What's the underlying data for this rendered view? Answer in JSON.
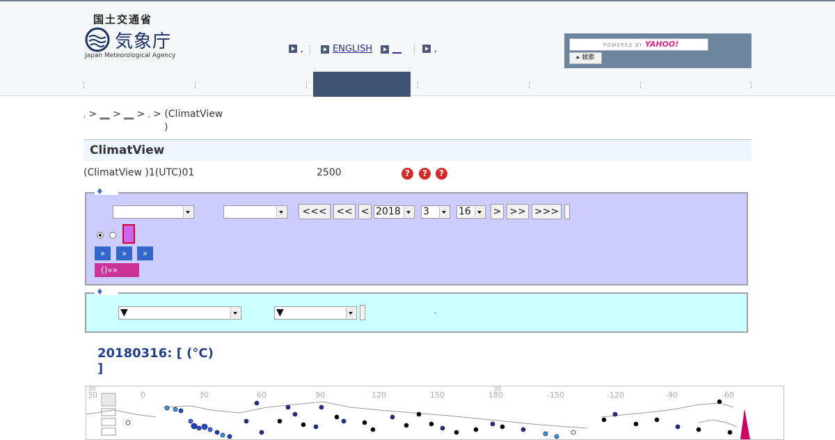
{
  "header": {
    "agency_kanji_top": "国土交通省",
    "agency_kanji_main": "気象庁",
    "agency_english": "Japan Meteorological Agency",
    "links": [
      {
        "label": ",",
        "underline": false
      },
      {
        "label": "ENGLISH",
        "underline": true
      },
      {
        "label": "__",
        "underline": true
      },
      {
        "label": ",",
        "underline": false
      }
    ],
    "search": {
      "powered_by": "POWERED BY",
      "yahoo": "YAHOO!",
      "button_label": "検索"
    }
  },
  "breadcrumb": {
    "text1": ",",
    "sep1": ">",
    "link1": "__",
    "sep2": ">",
    "link2": "__",
    "sep3": ">",
    "text2": ",",
    "sep4": ">",
    "current_line1": "(ClimatView",
    "current_line2": ")"
  },
  "page": {
    "title": "ClimatView",
    "info_text": "(ClimatView )1(UTC)01",
    "info_count": "2500"
  },
  "panel1": {
    "diamond": "♦",
    "select_element": "",
    "select_period": "",
    "nav_buttons": [
      "<<<",
      "<<",
      "<",
      ">",
      ">>",
      ">>>"
    ],
    "year": "2018",
    "month": "3",
    "day": "16",
    "go_buttons": [
      "»",
      "»",
      "»"
    ],
    "pink_button": "()»»"
  },
  "panel2": {
    "diamond": "♦",
    "select_a": "▼",
    "select_b": "▼",
    "note": ","
  },
  "map": {
    "title_line1": "20180316: [ (°C)",
    "title_line2": "]",
    "lon_labels": [
      "30",
      "0",
      "30",
      "60",
      "90",
      "120",
      "150",
      "180",
      "-150",
      "-120",
      "-90",
      "-60"
    ],
    "lat_labels": [
      "30",
      "30"
    ]
  },
  "colors": {
    "header_bg": "#f6f7f8",
    "nav_active": "#3f5470",
    "panel1_bg": "#ccccff",
    "panel2_bg": "#ccffff",
    "blue_button": "#3366cc",
    "pink_button": "#cc3399"
  }
}
